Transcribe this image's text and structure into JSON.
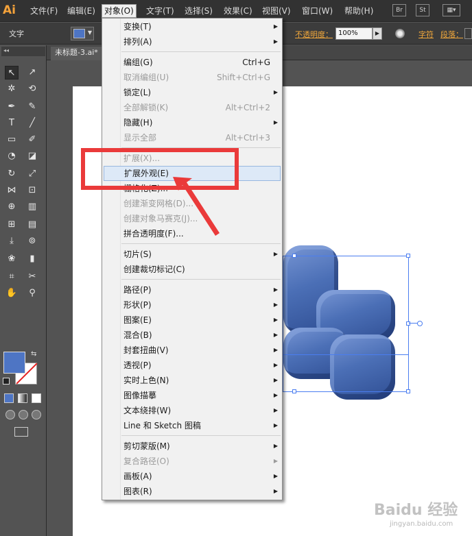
{
  "app": {
    "logo": "Ai"
  },
  "menubar": {
    "items": [
      "文件(F)",
      "编辑(E)",
      "对象(O)",
      "文字(T)",
      "选择(S)",
      "效果(C)",
      "视图(V)",
      "窗口(W)",
      "帮助(H)"
    ],
    "active": "对象(O)",
    "icons": {
      "bridge": "Br",
      "stock": "St"
    }
  },
  "controlbar": {
    "label": "文字",
    "fill_color": "#4e75c4",
    "opacity_label": "不透明度：",
    "opacity_value": "100%",
    "char_link": "字符",
    "para_link": "段落："
  },
  "document": {
    "tab_title": "未标题-3.ai*"
  },
  "object_menu": {
    "items": [
      {
        "label": "变换(T)",
        "arrow": true
      },
      {
        "label": "排列(A)",
        "arrow": true
      },
      {
        "label": "编组(G)",
        "shortcut": "Ctrl+G"
      },
      {
        "label": "取消编组(U)",
        "shortcut": "Shift+Ctrl+G",
        "disabled": true
      },
      {
        "label": "锁定(L)",
        "arrow": true
      },
      {
        "label": "全部解锁(K)",
        "shortcut": "Alt+Ctrl+2",
        "disabled": true
      },
      {
        "label": "隐藏(H)",
        "arrow": true
      },
      {
        "label": "显示全部",
        "shortcut": "Alt+Ctrl+3",
        "disabled": true
      },
      {
        "label": "扩展(X)...",
        "disabled": true
      },
      {
        "label": "扩展外观(E)",
        "highlight": true
      },
      {
        "label": "栅格化(Z)..."
      },
      {
        "label": "创建渐变网格(D)...",
        "disabled": true
      },
      {
        "label": "创建对象马赛克(J)...",
        "disabled": true
      },
      {
        "label": "拼合透明度(F)..."
      },
      {
        "label": "切片(S)",
        "arrow": true
      },
      {
        "label": "创建裁切标记(C)"
      },
      {
        "label": "路径(P)",
        "arrow": true
      },
      {
        "label": "形状(P)",
        "arrow": true
      },
      {
        "label": "图案(E)",
        "arrow": true
      },
      {
        "label": "混合(B)",
        "arrow": true
      },
      {
        "label": "封套扭曲(V)",
        "arrow": true
      },
      {
        "label": "透视(P)",
        "arrow": true
      },
      {
        "label": "实时上色(N)",
        "arrow": true
      },
      {
        "label": "图像描摹",
        "arrow": true
      },
      {
        "label": "文本绕排(W)",
        "arrow": true
      },
      {
        "label": "Line 和 Sketch 图稿",
        "arrow": true
      },
      {
        "label": "剪切蒙版(M)",
        "arrow": true
      },
      {
        "label": "复合路径(O)",
        "arrow": true,
        "disabled": true
      },
      {
        "label": "画板(A)",
        "arrow": true
      },
      {
        "label": "图表(R)",
        "arrow": true
      }
    ]
  },
  "colors": {
    "fill": "#4e75c4",
    "callout": "#ea3a3a",
    "selection": "#4a7df0"
  },
  "watermark": {
    "brand": "Baidu 经验",
    "url": "jingyan.baidu.com"
  }
}
